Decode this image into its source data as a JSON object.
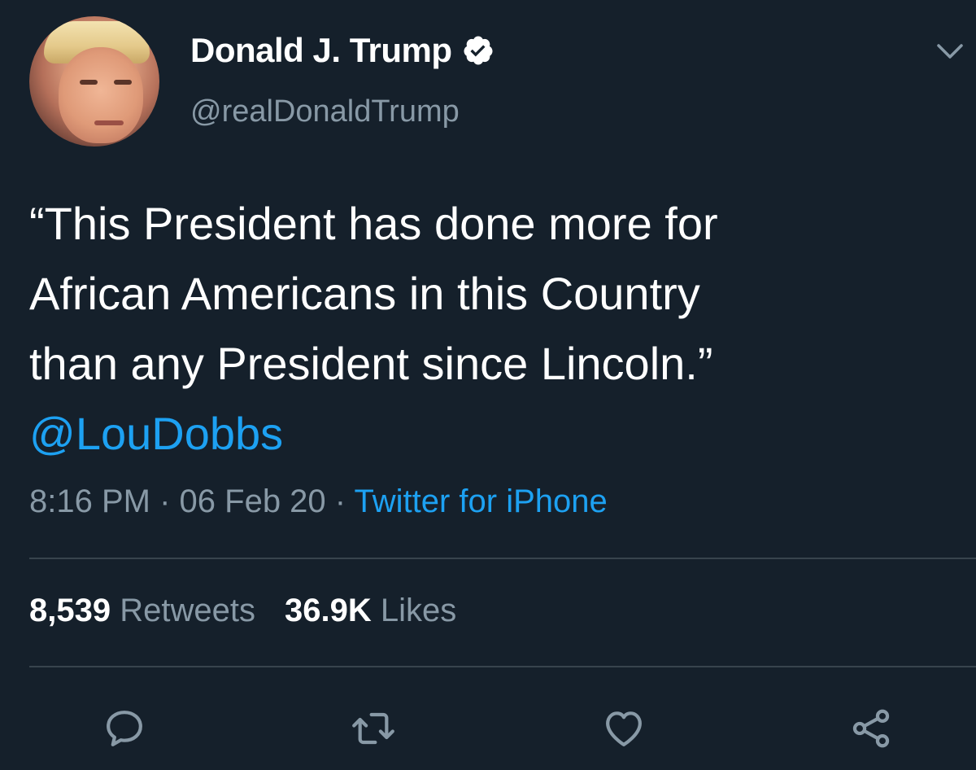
{
  "user": {
    "name": "Donald J. Trump",
    "handle": "@realDonaldTrump",
    "verified": true
  },
  "tweet": {
    "lines": [
      "“This President has done more for",
      "African Americans in this Country",
      "than any President since Lincoln.”"
    ],
    "mention": "@LouDobbs",
    "time": "8:16 PM",
    "date": "06 Feb 20",
    "source": "Twitter for iPhone"
  },
  "stats": {
    "retweets_count": "8,539",
    "retweets_label": "Retweets",
    "likes_count": "36.9K",
    "likes_label": "Likes"
  },
  "icons": {
    "reply": "reply-icon",
    "retweet": "retweet-icon",
    "like": "heart-icon",
    "share": "share-icon",
    "menu": "chevron-down-icon",
    "verified": "verified-badge-icon"
  },
  "colors": {
    "background": "#15202b",
    "accent": "#1da1f2",
    "secondary_text": "#8899a6",
    "divider": "#38444d"
  }
}
